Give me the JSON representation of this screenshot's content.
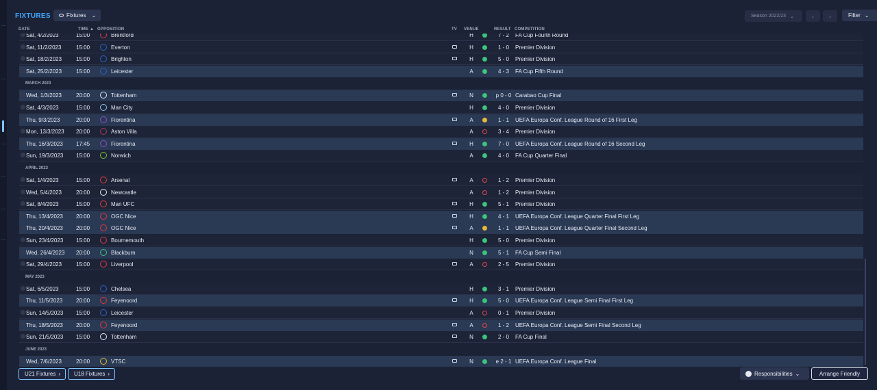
{
  "page": {
    "title": "FIXTURES"
  },
  "toolbar": {
    "view_label": "Fixtures",
    "season_label": "Season 2022/23",
    "filter_label": "Filter"
  },
  "columns": {
    "date": "DATE",
    "time": "TIME",
    "opposition": "OPPOSITION",
    "tv": "TV",
    "venue": "VENUE",
    "result": "RESULT",
    "competition": "COMPETITION"
  },
  "months": [
    "MARCH 2023",
    "APRIL 2023",
    "MAY 2023",
    "JUNE 2023"
  ],
  "fixtures": [
    {
      "date": "Sat, 4/2/2023",
      "time": "15:00",
      "opposition": "Brentford",
      "tv": false,
      "venue": "H",
      "outcome": "win",
      "result": "7 - 2",
      "competition": "FA Cup Fourth Round",
      "crest_color": "#e03a3e"
    },
    {
      "date": "Sat, 11/2/2023",
      "time": "15:00",
      "opposition": "Everton",
      "tv": true,
      "venue": "H",
      "outcome": "win",
      "result": "1 - 0",
      "competition": "Premier Division",
      "crest_color": "#2a64c8"
    },
    {
      "date": "Sat, 18/2/2023",
      "time": "15:00",
      "opposition": "Brighton",
      "tv": true,
      "venue": "H",
      "outcome": "win",
      "result": "5 - 0",
      "competition": "Premier Division",
      "crest_color": "#2a64c8"
    },
    {
      "date": "Sat, 25/2/2023",
      "time": "15:00",
      "opposition": "Leicester",
      "tv": false,
      "venue": "A",
      "outcome": "win",
      "result": "4 - 3",
      "competition": "FA Cup Fifth Round",
      "crest_color": "#2a64c8"
    },
    {
      "date": "Wed, 1/3/2023",
      "time": "20:00",
      "opposition": "Tottenham",
      "tv": true,
      "venue": "N",
      "outcome": "win",
      "result": "p 0 - 0",
      "competition": "Carabao Cup Final",
      "crest_color": "#e6eaf2"
    },
    {
      "date": "Sat, 4/3/2023",
      "time": "15:00",
      "opposition": "Man City",
      "tv": false,
      "venue": "H",
      "outcome": "win",
      "result": "4 - 0",
      "competition": "Premier Division",
      "crest_color": "#8ec5ea"
    },
    {
      "date": "Thu, 9/3/2023",
      "time": "20:00",
      "opposition": "Fiorentina",
      "tv": true,
      "venue": "A",
      "outcome": "draw",
      "result": "1 - 1",
      "competition": "UEFA Europa Conf. League Round of 16  First Leg",
      "crest_color": "#8a4fc8"
    },
    {
      "date": "Mon, 13/3/2023",
      "time": "20:00",
      "opposition": "Aston Villa",
      "tv": false,
      "venue": "A",
      "outcome": "loss",
      "result": "3 - 4",
      "competition": "Premier Division",
      "crest_color": "#a83a5c"
    },
    {
      "date": "Thu, 16/3/2023",
      "time": "17:45",
      "opposition": "Fiorentina",
      "tv": true,
      "venue": "H",
      "outcome": "win",
      "result": "7 - 0",
      "competition": "UEFA Europa Conf. League Round of 16  Second Leg",
      "crest_color": "#8a4fc8"
    },
    {
      "date": "Sun, 19/3/2023",
      "time": "15:00",
      "opposition": "Norwich",
      "tv": false,
      "venue": "A",
      "outcome": "win",
      "result": "4 - 0",
      "competition": "FA Cup Quarter Final",
      "crest_color": "#7ac23a"
    },
    {
      "date": "Sat, 1/4/2023",
      "time": "15:00",
      "opposition": "Arsenal",
      "tv": true,
      "venue": "A",
      "outcome": "loss",
      "result": "1 - 2",
      "competition": "Premier Division",
      "crest_color": "#e03a3e"
    },
    {
      "date": "Wed, 5/4/2023",
      "time": "20:00",
      "opposition": "Newcastle",
      "tv": false,
      "venue": "A",
      "outcome": "loss",
      "result": "1 - 2",
      "competition": "Premier Division",
      "crest_color": "#e6eaf2"
    },
    {
      "date": "Sat, 8/4/2023",
      "time": "15:00",
      "opposition": "Man UFC",
      "tv": true,
      "venue": "H",
      "outcome": "win",
      "result": "5 - 1",
      "competition": "Premier Division",
      "crest_color": "#e03a3e"
    },
    {
      "date": "Thu, 13/4/2023",
      "time": "20:00",
      "opposition": "OGC Nice",
      "tv": true,
      "venue": "H",
      "outcome": "win",
      "result": "4 - 1",
      "competition": "UEFA Europa Conf. League Quarter Final First Leg",
      "crest_color": "#e03a3e"
    },
    {
      "date": "Thu, 20/4/2023",
      "time": "20:00",
      "opposition": "OGC Nice",
      "tv": true,
      "venue": "A",
      "outcome": "draw",
      "result": "1 - 1",
      "competition": "UEFA Europa Conf. League Quarter Final Second Leg",
      "crest_color": "#e03a3e"
    },
    {
      "date": "Sun, 23/4/2023",
      "time": "15:00",
      "opposition": "Bournemouth",
      "tv": false,
      "venue": "H",
      "outcome": "win",
      "result": "5 - 0",
      "competition": "Premier Division",
      "crest_color": "#e03a3e"
    },
    {
      "date": "Wed, 26/4/2023",
      "time": "20:00",
      "opposition": "Blackburn",
      "tv": false,
      "venue": "N",
      "outcome": "win",
      "result": "5 - 1",
      "competition": "FA Cup Semi Final",
      "crest_color": "#3cc47c"
    },
    {
      "date": "Sat, 29/4/2023",
      "time": "15:00",
      "opposition": "Liverpool",
      "tv": true,
      "venue": "A",
      "outcome": "loss",
      "result": "2 - 5",
      "competition": "Premier Division",
      "crest_color": "#e03a3e"
    },
    {
      "date": "Sat, 6/5/2023",
      "time": "15:00",
      "opposition": "Chelsea",
      "tv": false,
      "venue": "H",
      "outcome": "win",
      "result": "3 - 1",
      "competition": "Premier Division",
      "crest_color": "#2a64c8"
    },
    {
      "date": "Thu, 11/5/2023",
      "time": "20:00",
      "opposition": "Feyenoord",
      "tv": true,
      "venue": "H",
      "outcome": "win",
      "result": "5 - 0",
      "competition": "UEFA Europa Conf. League Semi Final First Leg",
      "crest_color": "#e03a3e"
    },
    {
      "date": "Sun, 14/5/2023",
      "time": "15:00",
      "opposition": "Leicester",
      "tv": false,
      "venue": "A",
      "outcome": "loss",
      "result": "0 - 1",
      "competition": "Premier Division",
      "crest_color": "#2a64c8"
    },
    {
      "date": "Thu, 18/5/2023",
      "time": "20:00",
      "opposition": "Feyenoord",
      "tv": true,
      "venue": "A",
      "outcome": "loss",
      "result": "1 - 2",
      "competition": "UEFA Europa Conf. League Semi Final Second Leg",
      "crest_color": "#e03a3e"
    },
    {
      "date": "Sun, 21/5/2023",
      "time": "15:00",
      "opposition": "Tottenham",
      "tv": true,
      "venue": "N",
      "outcome": "win",
      "result": "2 - 0",
      "competition": "FA Cup Final",
      "crest_color": "#e6eaf2"
    },
    {
      "date": "Wed, 7/6/2023",
      "time": "20:00",
      "opposition": "VTSC",
      "tv": true,
      "venue": "N",
      "outcome": "win",
      "result": "e 2 - 1",
      "competition": "UEFA Europa Conf. League Final",
      "crest_color": "#e8b838"
    }
  ],
  "footer": {
    "u21_label": "U21 Fixtures",
    "u18_label": "U18 Fixtures",
    "responsibilities_label": "Responsibilities",
    "arrange_label": "Arrange Friendly"
  }
}
